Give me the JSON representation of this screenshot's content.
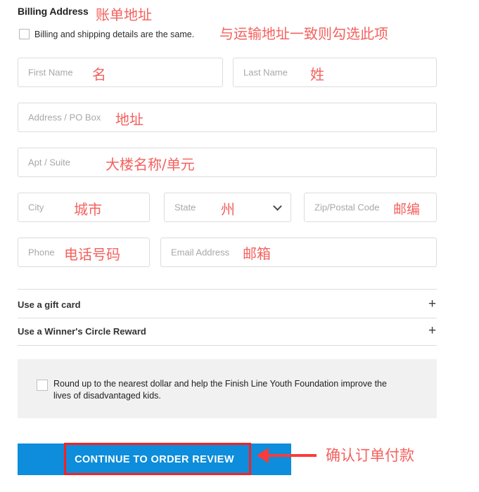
{
  "section": {
    "title": "Billing Address",
    "title_annotation": "账单地址"
  },
  "same_as_shipping": {
    "label": "Billing and shipping details are the same.",
    "annotation": "与运输地址一致则勾选此项",
    "checked": false
  },
  "fields": [
    {
      "name": "first-name",
      "placeholder": "First Name",
      "annotation": "名",
      "value": ""
    },
    {
      "name": "last-name",
      "placeholder": "Last Name",
      "annotation": "姓",
      "value": ""
    },
    {
      "name": "address",
      "placeholder": "Address / PO Box",
      "annotation": "地址",
      "value": ""
    },
    {
      "name": "apt-suite",
      "placeholder": "Apt / Suite",
      "annotation": "大楼名称/单元",
      "value": ""
    },
    {
      "name": "city",
      "placeholder": "City",
      "annotation": "城市",
      "value": ""
    },
    {
      "name": "state",
      "placeholder": "State",
      "annotation": "州",
      "value": ""
    },
    {
      "name": "zip",
      "placeholder": "Zip/Postal Code",
      "annotation": "邮编",
      "value": ""
    },
    {
      "name": "phone",
      "placeholder": "Phone",
      "annotation": "电话号码",
      "value": ""
    },
    {
      "name": "email",
      "placeholder": "Email Address",
      "annotation": "邮箱",
      "value": ""
    }
  ],
  "accordions": [
    {
      "label": "Use a gift card",
      "toggle": "+"
    },
    {
      "label": "Use a Winner's Circle Reward",
      "toggle": "+"
    }
  ],
  "roundup": {
    "text": "Round up to the nearest dollar and help the Finish Line Youth Foundation improve the lives of disadvantaged kids.",
    "checked": false
  },
  "cta": {
    "label": "CONTINUE TO ORDER REVIEW",
    "annotation": "确认订单付款",
    "color": "#0d8ddb"
  },
  "colors": {
    "accent": "#0d8ddb",
    "annotation_red": "#f4615e",
    "highlight_red": "#fb1f1f",
    "panel_gray": "#f1f1f1",
    "border_gray": "#dcdcdc"
  }
}
